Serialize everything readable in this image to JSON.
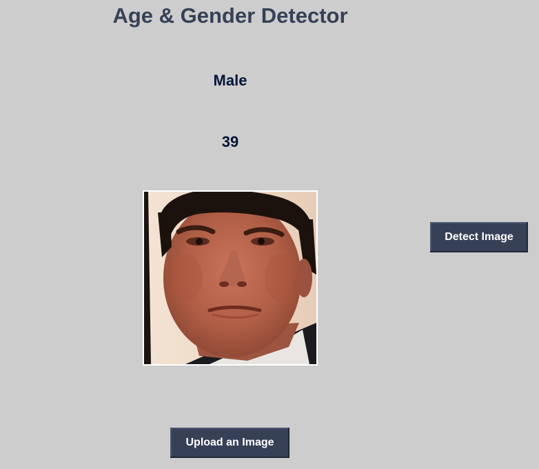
{
  "app": {
    "title": "Age & Gender Detector"
  },
  "result": {
    "gender": "Male",
    "age": "39"
  },
  "photo": {
    "subject": "face-photo",
    "description": ""
  },
  "buttons": {
    "detect_label": "Detect Image",
    "upload_label": "Upload an Image"
  },
  "colors": {
    "background": "#cdcdcd",
    "title": "#364156",
    "result_text": "#011638",
    "button_bg": "#364156",
    "button_text": "#ffffff"
  }
}
